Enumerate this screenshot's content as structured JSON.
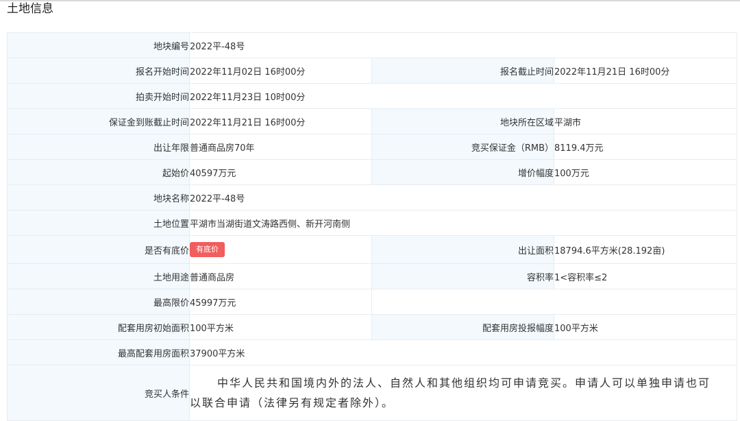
{
  "section_title": "土地信息",
  "rows": {
    "plot_number": {
      "label": "地块编号",
      "value": "2022平-48号"
    },
    "reg_start": {
      "label": "报名开始时间",
      "value": "2022年11月02日 16时00分"
    },
    "reg_end": {
      "label": "报名截止时间",
      "value": "2022年11月21日 16时00分"
    },
    "auction_start": {
      "label": "拍卖开始时间",
      "value": "2022年11月23日 10时00分"
    },
    "deposit_deadline": {
      "label": "保证金到账截止时间",
      "value": "2022年11月21日 16时00分"
    },
    "region": {
      "label": "地块所在区域",
      "value": "平湖市"
    },
    "term": {
      "label": "出让年限",
      "value": "普通商品房70年"
    },
    "deposit": {
      "label": "竞买保证金（RMB）",
      "value": "8119.4万元"
    },
    "start_price": {
      "label": "起始价",
      "value": "40597万元"
    },
    "increment": {
      "label": "增价幅度",
      "value": "100万元"
    },
    "plot_name": {
      "label": "地块名称",
      "value": "2022平-48号"
    },
    "location": {
      "label": "土地位置",
      "value": "平湖市当湖街道文涛路西侧、新开河南侧"
    },
    "reserve_price": {
      "label": "是否有底价",
      "badge": "有底价",
      "badge_color": "#f25d5d"
    },
    "area": {
      "label": "出让面积",
      "value": "18794.6平方米(28.192亩)"
    },
    "usage": {
      "label": "土地用途",
      "value": "普通商品房"
    },
    "far": {
      "label": "容积率",
      "value": "1<容积率≤2"
    },
    "max_price": {
      "label": "最高限价",
      "value": "45997万元"
    },
    "housing_init_area": {
      "label": "配套用房初始面积",
      "value": "100平方米"
    },
    "housing_bid_step": {
      "label": "配套用房投报幅度",
      "value": "100平方米"
    },
    "housing_max_area": {
      "label": "最高配套用房面积",
      "value": "37900平方米"
    },
    "bidder_conditions": {
      "label": "竞买人条件",
      "value": "中华人民共和国境内外的法人、自然人和其他组织均可申请竞买。申请人可以单独申请也可以联合申请（法律另有规定者除外）。"
    }
  },
  "colors": {
    "label_bg": "#f3f9fd",
    "border": "#e8ecef",
    "badge": "#f25d5d"
  }
}
